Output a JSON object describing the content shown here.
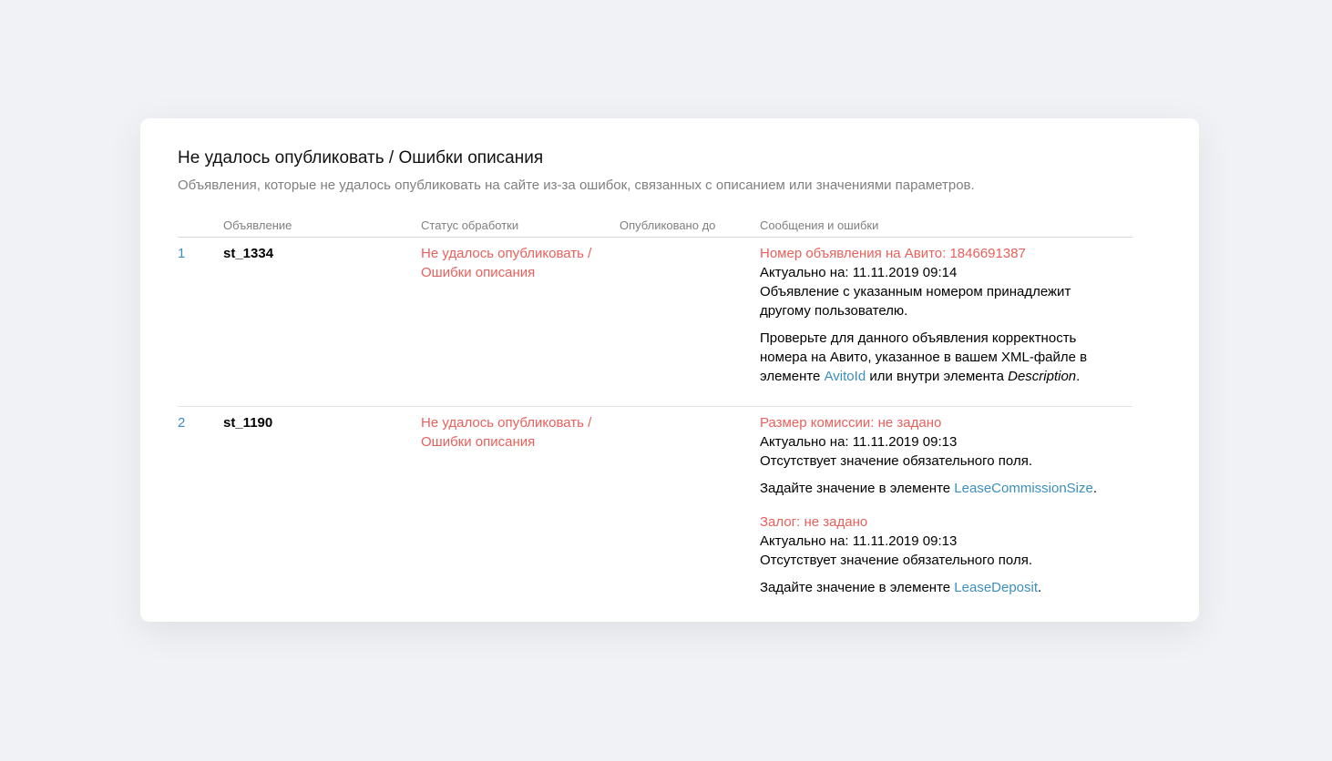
{
  "section": {
    "title": "Не удалось опубликовать / Ошибки описания",
    "subtitle": "Объявления, которые не удалось опубликовать на сайте из-за ошибок, связанных с описанием или значениями параметров."
  },
  "table": {
    "headers": {
      "ad": "Объявление",
      "status": "Статус обработки",
      "published_until": "Опубликовано до",
      "messages": "Сообщения и ошибки"
    },
    "rows": [
      {
        "num": "1",
        "ad": "st_1334",
        "status_line1": "Не удалось опубликовать /",
        "status_line2": "Ошибки описания",
        "published_until": "",
        "messages": [
          {
            "title": "Номер объявления на Авито: 1846691387",
            "date": "Актуально на: 11.11.2019 09:14",
            "text": "Объявление с указанным номером принадлежит другому пользователю.",
            "hint_prefix": "Проверьте для данного объявления корректность номера на Авито, указанное в вашем XML-файле в элементе ",
            "hint_link": "AvitoId",
            "hint_mid": " или внутри элемента ",
            "hint_em": "Description",
            "hint_suffix": "."
          }
        ]
      },
      {
        "num": "2",
        "ad": "st_1190",
        "status_line1": "Не удалось опубликовать /",
        "status_line2": "Ошибки описания",
        "published_until": "",
        "messages": [
          {
            "title": "Размер комиссии: не задано",
            "date": "Актуально на: 11.11.2019 09:13",
            "text": "Отсутствует значение обязательного поля.",
            "hint_prefix": "Задайте значение в элементе ",
            "hint_link": "LeaseCommissionSize",
            "hint_suffix": "."
          },
          {
            "title": "Залог: не задано",
            "date": "Актуально на: 11.11.2019 09:13",
            "text": "Отсутствует значение обязательного поля.",
            "hint_prefix": "Задайте значение в элементе ",
            "hint_link": "LeaseDeposit",
            "hint_suffix": "."
          }
        ]
      }
    ]
  },
  "colors": {
    "background": "#f1f2f5",
    "error": "#e8605c",
    "link": "#3b8fbe",
    "muted": "#808080"
  }
}
